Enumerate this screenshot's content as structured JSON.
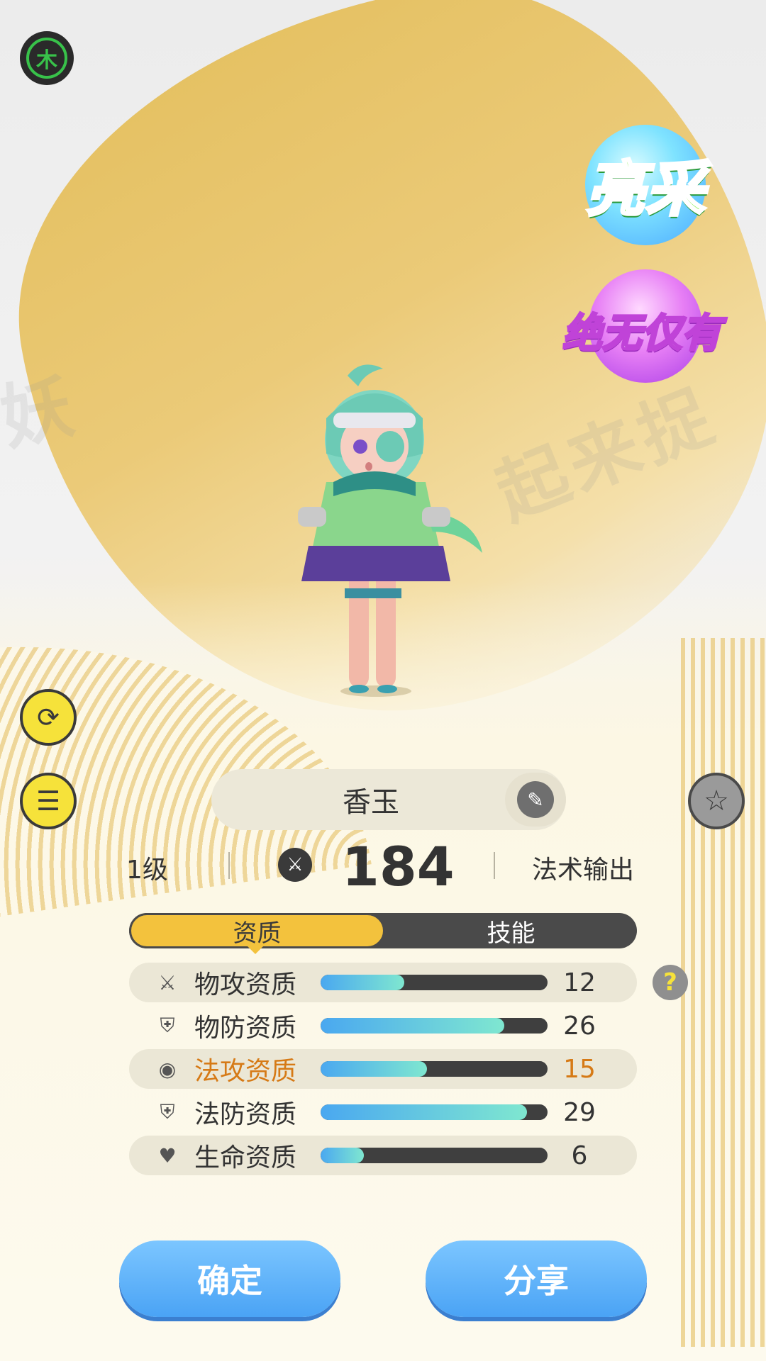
{
  "element_badge": "木",
  "tags": {
    "rarity": "亮采",
    "unique": "绝无仅有"
  },
  "side_buttons": {
    "rotate_icon": "rotate-icon",
    "list_icon": "list-icon",
    "star_icon": "star-icon"
  },
  "pet": {
    "name": "香玉",
    "level": "1级",
    "power": "184",
    "role": "法术输出"
  },
  "tabs": [
    {
      "label": "资质",
      "active": true
    },
    {
      "label": "技能",
      "active": false
    }
  ],
  "stats": [
    {
      "icon": "sword-icon",
      "label": "物攻资质",
      "value": "12",
      "fill": 0.37,
      "highlight": false
    },
    {
      "icon": "shield-icon",
      "label": "物防资质",
      "value": "26",
      "fill": 0.81,
      "highlight": false
    },
    {
      "icon": "magic-orb-icon",
      "label": "法攻资质",
      "value": "15",
      "fill": 0.47,
      "highlight": true
    },
    {
      "icon": "shield-icon",
      "label": "法防资质",
      "value": "29",
      "fill": 0.91,
      "highlight": false
    },
    {
      "icon": "heart-icon",
      "label": "生命资质",
      "value": "6",
      "fill": 0.19,
      "highlight": false
    }
  ],
  "help": "?",
  "buttons": {
    "confirm": "确定",
    "share": "分享"
  },
  "colors": {
    "accent": "#f3c23d",
    "bar_fill": "#4aa8f0",
    "highlight_text": "#d67a16",
    "button_blue": "#4aa3f5"
  }
}
